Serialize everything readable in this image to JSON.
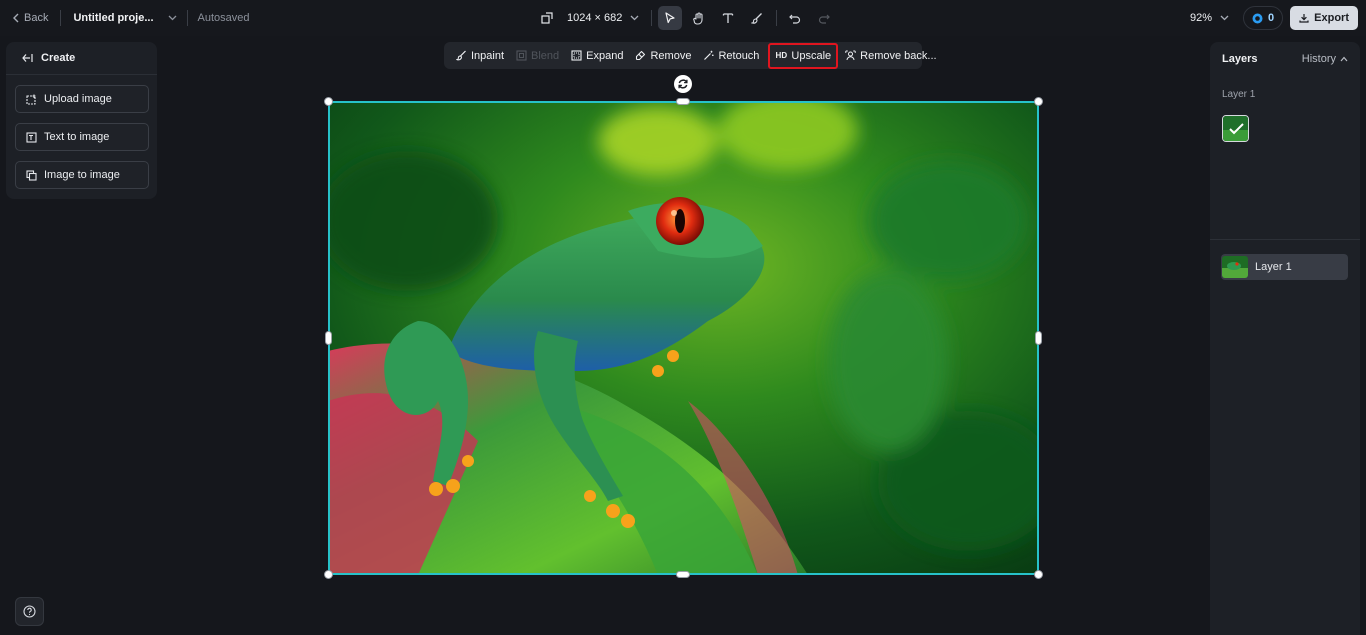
{
  "topbar": {
    "back_label": "Back",
    "project_title": "Untitled proje...",
    "autosaved_label": "Autosaved",
    "canvas_size": "1024 × 682",
    "zoom": "92%",
    "credits": "0",
    "export_label": "Export"
  },
  "tools": [
    {
      "name": "select-tool",
      "icon": "cursor-arrow-icon",
      "active": true
    },
    {
      "name": "hand-tool",
      "icon": "hand-icon",
      "active": false
    },
    {
      "name": "text-tool",
      "icon": "text-t-icon",
      "active": false
    },
    {
      "name": "brush-tool",
      "icon": "brush-icon",
      "active": false
    },
    {
      "name": "undo",
      "icon": "undo-icon",
      "active": false
    },
    {
      "name": "redo",
      "icon": "redo-icon",
      "disabled": true
    }
  ],
  "left_panel": {
    "header": "Create",
    "buttons": [
      "Upload image",
      "Text to image",
      "Image to image"
    ]
  },
  "edit_toolbar": {
    "inpaint": "Inpaint",
    "blend": "Blend",
    "expand": "Expand",
    "remove": "Remove",
    "retouch": "Retouch",
    "upscale_badge": "HD",
    "upscale": "Upscale",
    "remove_background": "Remove back..."
  },
  "right_panel": {
    "tab_layers": "Layers",
    "tab_history": "History",
    "section_label": "Layer 1",
    "layer_name": "Layer 1"
  },
  "colors": {
    "selection": "#27c2c9",
    "highlight": "#e0151f",
    "background": "#15171c",
    "panel": "#1d2026"
  }
}
